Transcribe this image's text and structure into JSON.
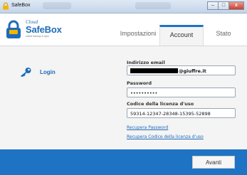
{
  "window": {
    "title": "SafeBox",
    "minimize": "–",
    "maximize": "□",
    "close": "x"
  },
  "logo": {
    "line1": "Cloud",
    "line2": "SafeBox",
    "line3": "online backup & sync"
  },
  "tabs": [
    {
      "label": "Impostazioni"
    },
    {
      "label": "Account"
    },
    {
      "label": "Stato"
    }
  ],
  "sidebar": {
    "login_label": "Login"
  },
  "form": {
    "email_label": "Indirizzo email",
    "email_value_suffix": "@giuffre.it",
    "password_label": "Password",
    "password_value": "••••••••••",
    "license_label": "Codice della licenza d'uso",
    "license_value": "59314-12347-28348-15395-52898",
    "recover_password": "Recupera Password",
    "recover_license": "Recupera Codice della licenza d'uso"
  },
  "footer": {
    "next_button": "Avanti"
  },
  "colors": {
    "accent": "#1e73c4",
    "link": "#1e6bb8"
  }
}
